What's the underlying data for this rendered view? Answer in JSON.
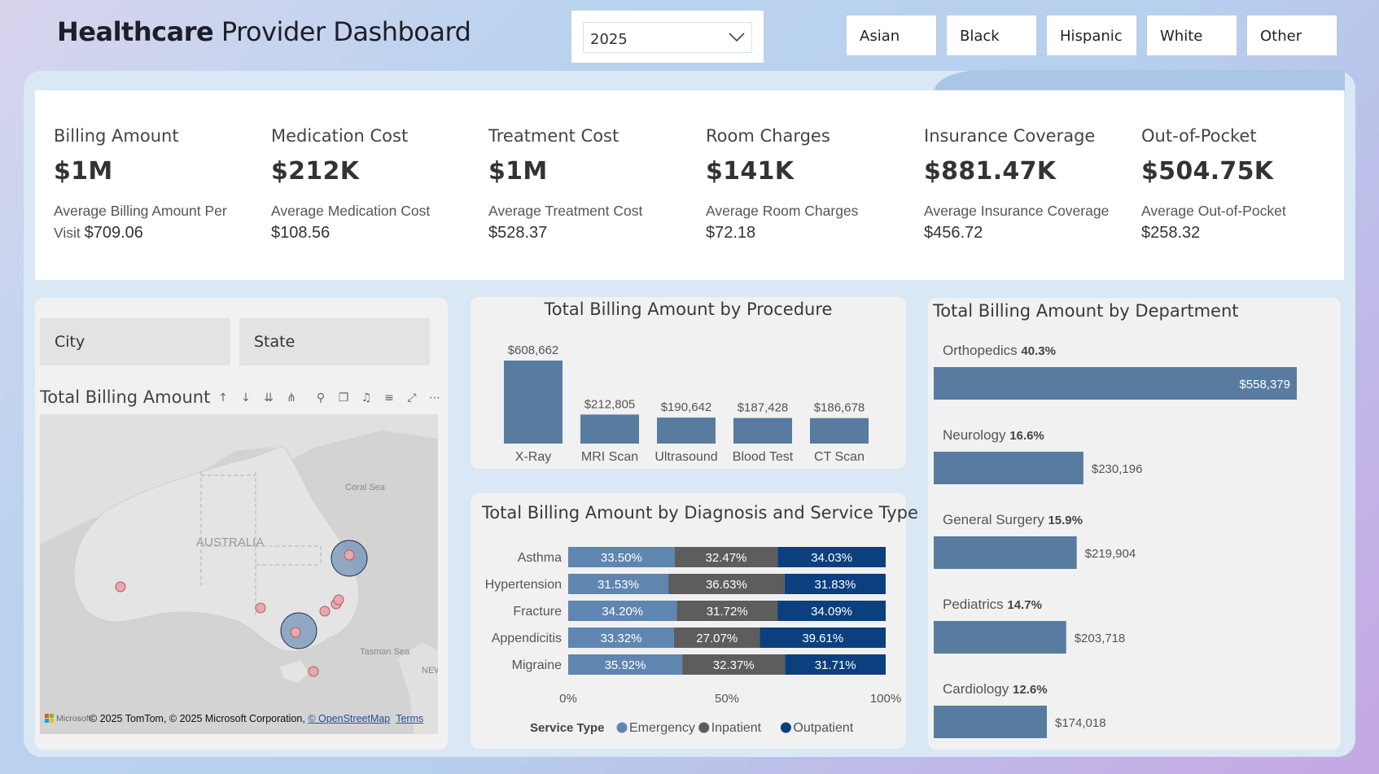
{
  "header": {
    "title_bold": "Healthcare",
    "title_rest": "Provider Dashboard",
    "year_value": "2025",
    "ethnicity_buttons": [
      "Asian",
      "Black",
      "Hispanic",
      "White",
      "Other"
    ]
  },
  "kpis": [
    {
      "label": "Billing Amount",
      "value": "$1M",
      "sub_label": "Average Billing Amount Per Visit",
      "sub_value": "$709.06"
    },
    {
      "label": "Medication Cost",
      "value": "$212K",
      "sub_label": "Average Medication Cost",
      "sub_value": "$108.56"
    },
    {
      "label": "Treatment Cost",
      "value": "$1M",
      "sub_label": "Average Treatment Cost",
      "sub_value": "$528.37"
    },
    {
      "label": "Room Charges",
      "value": "$141K",
      "sub_label": "Average Room Charges",
      "sub_value": "$72.18"
    },
    {
      "label": "Insurance Coverage",
      "value": "$881.47K",
      "sub_label": "Average Insurance Coverage",
      "sub_value": "$456.72"
    },
    {
      "label": "Out-of-Pocket",
      "value": "$504.75K",
      "sub_label": "Average Out-of-Pocket",
      "sub_value": "$258.32"
    }
  ],
  "slicers": {
    "city": "City",
    "state": "State"
  },
  "map": {
    "title": "Total Billing Amount b",
    "labels": {
      "country": "AUSTRALIA",
      "coral": "Coral Sea",
      "tasman": "Tasman Sea",
      "nz": "NEW"
    },
    "brand": "Microsoft",
    "attribution": "© 2025 TomTom, © 2025 Microsoft Corporation,",
    "osm_link": "© OpenStreetMap",
    "terms_link": "Terms"
  },
  "colors": {
    "bar": "#587c9f",
    "emergency": "#5f86b0",
    "inpatient": "#5d5d5d",
    "outpatient": "#0c3f7e"
  },
  "chart_data": [
    {
      "type": "bar",
      "title": "Total Billing Amount by Procedure",
      "categories": [
        "X-Ray",
        "MRI Scan",
        "Ultrasound",
        "Blood Test",
        "CT Scan"
      ],
      "values": [
        608662,
        212805,
        190642,
        187428,
        186678
      ],
      "data_labels": [
        "$608,662",
        "$212,805",
        "$190,642",
        "$187,428",
        "$186,678"
      ]
    },
    {
      "type": "bar",
      "orientation": "horizontal-stacked-100",
      "title": "Total Billing Amount by Diagnosis and Service Type",
      "categories": [
        "Asthma",
        "Hypertension",
        "Fracture",
        "Appendicitis",
        "Migraine"
      ],
      "series": [
        {
          "name": "Emergency",
          "values": [
            33.5,
            31.53,
            34.2,
            33.32,
            35.92
          ]
        },
        {
          "name": "Inpatient",
          "values": [
            32.47,
            36.63,
            31.72,
            27.07,
            32.37
          ]
        },
        {
          "name": "Outpatient",
          "values": [
            34.03,
            31.83,
            34.09,
            39.61,
            31.71
          ]
        }
      ],
      "x_ticks": [
        "0%",
        "50%",
        "100%"
      ],
      "legend_title": "Service Type",
      "legend": "bottom"
    },
    {
      "type": "bar",
      "orientation": "horizontal",
      "title": "Total Billing Amount by Department",
      "categories": [
        "Orthopedics",
        "Neurology",
        "General Surgery",
        "Pediatrics",
        "Cardiology"
      ],
      "shares": [
        "40.3%",
        "16.6%",
        "15.9%",
        "14.7%",
        "12.6%"
      ],
      "values": [
        558379,
        230196,
        219904,
        203718,
        174018
      ],
      "data_labels": [
        "$558,379",
        "$230,196",
        "$219,904",
        "$203,718",
        "$174,018"
      ]
    }
  ]
}
